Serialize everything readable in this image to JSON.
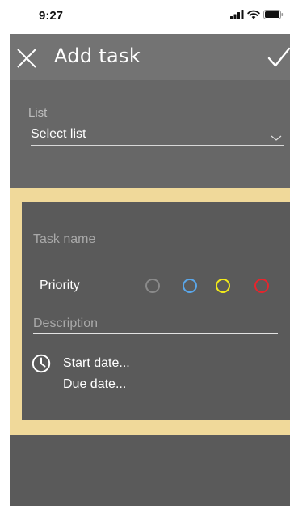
{
  "status_bar": {
    "time": "9:27",
    "icons": [
      "signal-icon",
      "wifi-icon",
      "battery-icon"
    ]
  },
  "app_bar": {
    "title": "Add task",
    "close_icon": "close-icon",
    "confirm_icon": "checkmark-icon"
  },
  "list_field": {
    "label": "List",
    "value": "Select list",
    "icon": "chevron-down-icon"
  },
  "task_form": {
    "task_name_placeholder": "Task name",
    "priority_label": "Priority",
    "priority_options": [
      {
        "name": "none",
        "color": "#8a8a8a"
      },
      {
        "name": "low",
        "color": "#5aa7ea"
      },
      {
        "name": "medium",
        "color": "#f2ea1a"
      },
      {
        "name": "high",
        "color": "#e8242c"
      }
    ],
    "description_placeholder": "Description",
    "start_date_label": "Start date...",
    "due_date_label": "Due date..."
  },
  "colors": {
    "app_bar_bg": "#737373",
    "list_section_bg": "#676767",
    "screen_bg": "#5a5a5a",
    "form_frame_bg": "#f0d99a"
  }
}
